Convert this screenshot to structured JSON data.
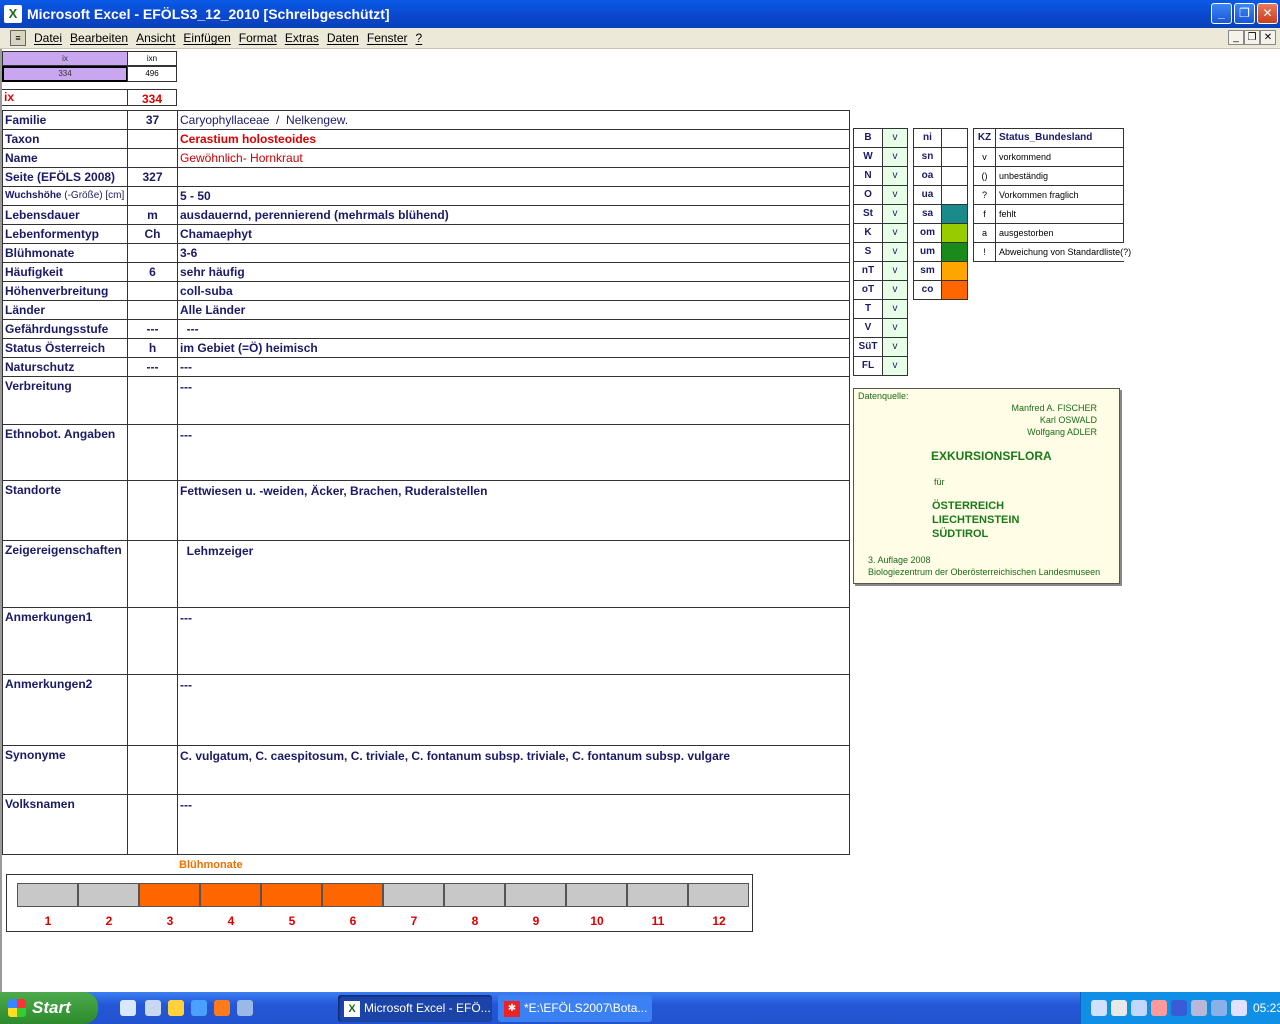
{
  "window": {
    "title": "Microsoft Excel - EFÖLS3_12_2010  [Schreibgeschützt]",
    "app_icon": "excel-icon",
    "minimize": "_",
    "restore": "❐",
    "close": "✕"
  },
  "menu": [
    "Datei",
    "Bearbeiten",
    "Ansicht",
    "Einfügen",
    "Format",
    "Extras",
    "Daten",
    "Fenster",
    "?"
  ],
  "topcells": {
    "h1": "ix",
    "h2": "ixn",
    "v1": "334",
    "v2": "496",
    "ix_label": "ix",
    "ix_value": "334"
  },
  "rows": [
    {
      "label": "Familie",
      "num": "37",
      "value": "Caryophyllaceae  /  Nelkengew."
    },
    {
      "label": "Taxon",
      "num": "",
      "value": "Cerastium holosteoides"
    },
    {
      "label": "Name",
      "num": "",
      "value": "Gewöhnlich- Hornkraut"
    },
    {
      "label": "Seite (EFÖLS 2008)",
      "num": "327",
      "value": ""
    },
    {
      "label": "Wuchshöhe",
      "label_small": "(-Größe) [cm]",
      "num": "",
      "value": "5 - 50"
    },
    {
      "label": "Lebensdauer",
      "num": "m",
      "value": "ausdauernd, perennierend (mehrmals blühend)"
    },
    {
      "label": "Lebenformentyp",
      "num": "Ch",
      "value": "Chamaephyt"
    },
    {
      "label": "Blühmonate",
      "num": "",
      "value": "3-6"
    },
    {
      "label": "Häufigkeit",
      "num": "6",
      "value": "sehr häufig"
    },
    {
      "label": "Höhenverbreitung",
      "num": "",
      "value": "coll-suba"
    },
    {
      "label": "Länder",
      "num": "",
      "value": "Alle Länder"
    },
    {
      "label": "Gefährdungsstufe",
      "num": "---",
      "value": "  ---"
    },
    {
      "label": "Status Österreich",
      "num": "h",
      "value": "im Gebiet (=Ö) heimisch"
    },
    {
      "label": "Naturschutz",
      "num": "---",
      "value": "---"
    },
    {
      "label": "Verbreitung",
      "num": "",
      "value": "---"
    },
    {
      "label": "Ethnobot. Angaben",
      "num": "",
      "value": "---"
    },
    {
      "label": "Standorte",
      "num": "",
      "value": "Fettwiesen u. -weiden, Äcker, Brachen, Ruderalstellen"
    },
    {
      "label": "Zeigereigenschaften",
      "num": "",
      "value": "  Lehmzeiger"
    },
    {
      "label": "Anmerkungen1",
      "num": "",
      "value": "---"
    },
    {
      "label": "Anmerkungen2",
      "num": "",
      "value": "---"
    },
    {
      "label": "Synonyme",
      "num": "",
      "value": "C. vulgatum, C. caespitosum, C. triviale, C. fontanum subsp. triviale, C. fontanum subsp. vulgare"
    },
    {
      "label": "Volksnamen",
      "num": "",
      "value": "---"
    }
  ],
  "states": [
    {
      "code": "B",
      "v": "v"
    },
    {
      "code": "W",
      "v": "v"
    },
    {
      "code": "N",
      "v": "v"
    },
    {
      "code": "O",
      "v": "v"
    },
    {
      "code": "St",
      "v": "v"
    },
    {
      "code": "K",
      "v": "v"
    },
    {
      "code": "S",
      "v": "v"
    },
    {
      "code": "nT",
      "v": "v"
    },
    {
      "code": "oT",
      "v": "v"
    },
    {
      "code": "T",
      "v": "v"
    },
    {
      "code": "V",
      "v": "v"
    },
    {
      "code": "SüT",
      "v": "v"
    },
    {
      "code": "FL",
      "v": "v"
    }
  ],
  "zones": [
    {
      "code": "ni",
      "color": "#ffffff"
    },
    {
      "code": "sn",
      "color": "#ffffff"
    },
    {
      "code": "oa",
      "color": "#ffffff"
    },
    {
      "code": "ua",
      "color": "#ffffff"
    },
    {
      "code": "sa",
      "color": "#1a8a8a"
    },
    {
      "code": "om",
      "color": "#99cc00"
    },
    {
      "code": "um",
      "color": "#1a8a1a"
    },
    {
      "code": "sm",
      "color": "#ffa500"
    },
    {
      "code": "co",
      "color": "#ff6600"
    }
  ],
  "legend": {
    "header_kz": "KZ",
    "header": "Status_Bundesland",
    "items": [
      {
        "k": "v",
        "t": "vorkommend"
      },
      {
        "k": "()",
        "t": "unbeständig"
      },
      {
        "k": "?",
        "t": "Vorkommen fraglich"
      },
      {
        "k": "f",
        "t": "fehlt"
      },
      {
        "k": "a",
        "t": "ausgestorben"
      },
      {
        "k": "!",
        "t": "Abweichung von Standardliste(?)"
      }
    ]
  },
  "source": {
    "title": "Datenquelle:",
    "authors": [
      "Manfred A. FISCHER",
      "Karl OSWALD",
      "Wolfgang ADLER"
    ],
    "book": "EXKURSIONSFLORA",
    "fuer": "für",
    "countries": [
      "ÖSTERREICH",
      "LIECHTENSTEIN",
      "SÜDTIROL"
    ],
    "edition": "3. Auflage 2008",
    "publisher": "Biologiezentrum der Oberösterreichischen Landesmuseen"
  },
  "bloom": {
    "title": "Blühmonate",
    "months": [
      "1",
      "2",
      "3",
      "4",
      "5",
      "6",
      "7",
      "8",
      "9",
      "10",
      "11",
      "12"
    ],
    "active": [
      3,
      4,
      5,
      6
    ],
    "active_color": "#ff6600",
    "inactive_color": "#c8c8c8"
  },
  "taskbar": {
    "start": "Start",
    "tasks": [
      "Microsoft Excel - EFÖ...",
      "*E:\\EFÖLS2007\\Bota..."
    ],
    "time": "05:23"
  }
}
